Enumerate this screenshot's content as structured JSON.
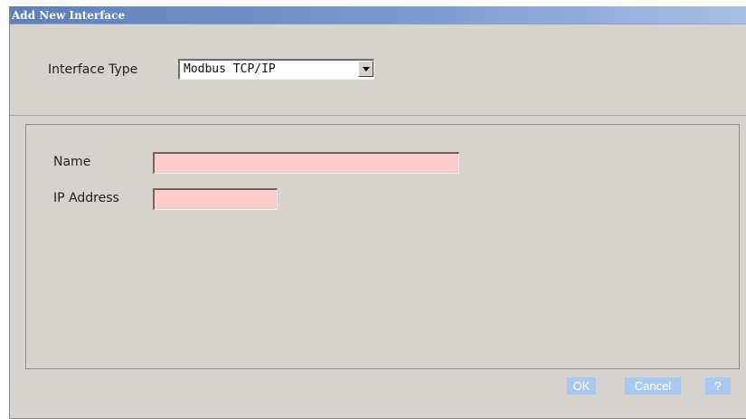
{
  "dialog": {
    "title": "Add New Interface"
  },
  "interface_type": {
    "label": "Interface Type",
    "selected": "Modbus TCP/IP"
  },
  "fields": {
    "name_label": "Name",
    "name_value": "",
    "ip_label": "IP Address",
    "ip_value": ""
  },
  "buttons": {
    "ok": "OK",
    "cancel": "Cancel",
    "help": "?"
  },
  "colors": {
    "title_bar": "#6d8cc6",
    "dialog_bg": "#d6d3ce",
    "required_field_bg": "#ffcccc",
    "button_bg": "#a9c9f0"
  },
  "icons": {
    "dropdown": "chevron-down-icon"
  }
}
